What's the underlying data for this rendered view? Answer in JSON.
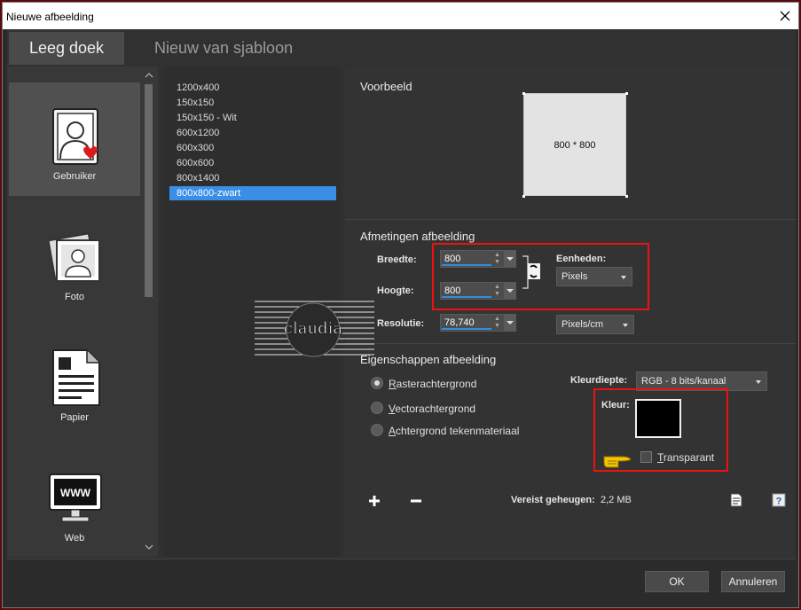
{
  "window": {
    "title": "Nieuwe afbeelding"
  },
  "tabs": [
    {
      "label": "Leeg doek"
    },
    {
      "label": "Nieuw van sjabloon"
    }
  ],
  "categories": [
    {
      "label": "Gebruiker",
      "icon": "user-card-icon"
    },
    {
      "label": "Foto",
      "icon": "photo-icon"
    },
    {
      "label": "Papier",
      "icon": "document-icon"
    },
    {
      "label": "Web",
      "icon": "www-monitor-icon"
    }
  ],
  "templates": [
    "1200x400",
    "150x150",
    "150x150 - Wit",
    "600x1200",
    "600x300",
    "600x600",
    "800x1400",
    "800x800-zwart"
  ],
  "selected_template": "800x800-zwart",
  "preview": {
    "title": "Voorbeeld",
    "label": "800 * 800"
  },
  "dimensions": {
    "title": "Afmetingen afbeelding",
    "width_label": "Breedte:",
    "width": "800",
    "height_label": "Hoogte:",
    "height": "800",
    "units_label": "Eenheden:",
    "units": "Pixels",
    "resolution_label": "Resolutie:",
    "resolution": "78,740",
    "resolution_units": "Pixels/cm"
  },
  "properties": {
    "title": "Eigenschappen afbeelding",
    "raster": {
      "accel": "R",
      "rest": "asterachtergrond"
    },
    "vector": {
      "accel": "V",
      "rest": "ectorachtergrond"
    },
    "art": {
      "accel": "A",
      "rest": "chtergrond tekenmateriaal"
    },
    "color_depth_label": "Kleurdiepte:",
    "color_depth": "RGB - 8 bits/kanaal",
    "color_label": "Kleur:",
    "transparent": {
      "accel": "T",
      "rest": "ransparant"
    },
    "color": "#000000"
  },
  "memory": {
    "label": "Vereist geheugen:",
    "value": "2,2 MB"
  },
  "buttons": {
    "ok": "OK",
    "cancel": "Annuleren"
  },
  "accent_color": "#3a8ee6",
  "highlight_color": "#ee1111"
}
